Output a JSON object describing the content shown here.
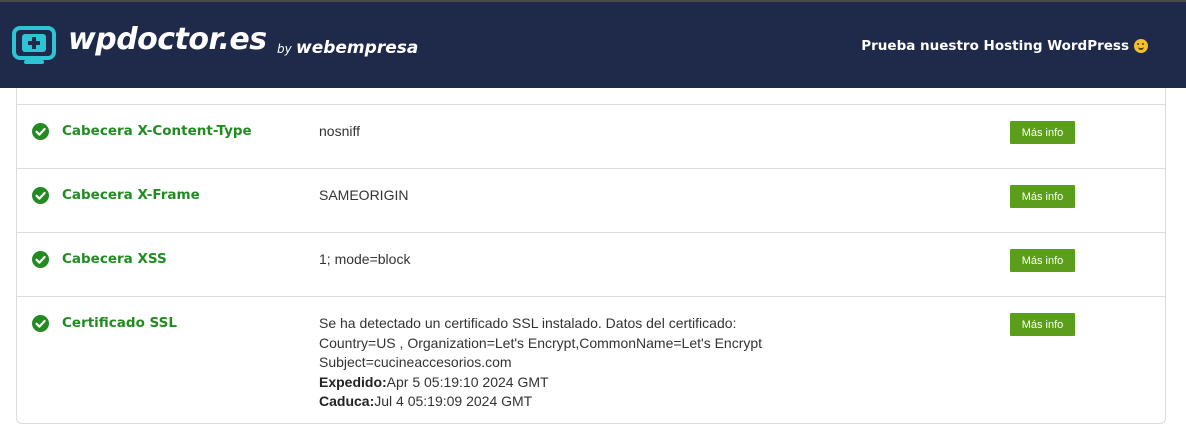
{
  "header": {
    "logo_text": "wpdoctor.es",
    "by_label": "by",
    "brand": "webempresa",
    "promo_text": "Prueba nuestro Hosting WordPress",
    "promo_icon": "smiling-face-emoji-icon",
    "background_color": "#1f2a4b",
    "logo_icon_color": "#2ec4d6"
  },
  "accent": {
    "ok_green": "#228b22",
    "button_green": "#5a9e1b"
  },
  "rows": [
    {
      "status": "ok",
      "label": "Cabecera X-Content-Type",
      "value": "nosniff",
      "button": "Más info"
    },
    {
      "status": "ok",
      "label": "Cabecera X-Frame",
      "value": "SAMEORIGIN",
      "button": "Más info"
    },
    {
      "status": "ok",
      "label": "Cabecera XSS",
      "value": "1; mode=block",
      "button": "Más info"
    },
    {
      "status": "ok",
      "label": "Certificado SSL",
      "value_lines": [
        "Se ha detectado un certificado SSL instalado. Datos del certificado:",
        "Country=US , Organization=Let's Encrypt,CommonName=Let's Encrypt",
        "Subject=cucineaccesorios.com"
      ],
      "issued_label": "Expedido:",
      "issued_value": "Apr 5 05:19:10 2024 GMT",
      "expires_label": "Caduca:",
      "expires_value": "Jul 4 05:19:09 2024 GMT",
      "button": "Más info"
    }
  ]
}
